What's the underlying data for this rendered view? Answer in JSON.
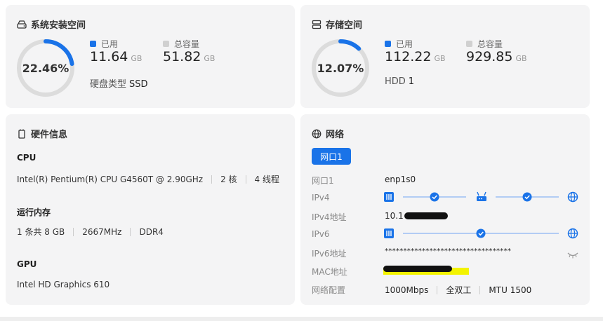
{
  "system_disk": {
    "title": "系统安装空间",
    "percent_text": "22.46%",
    "percent": 22.46,
    "used_label": "已用",
    "used_value": "11.64",
    "used_unit": "GB",
    "total_label": "总容量",
    "total_value": "51.82",
    "total_unit": "GB",
    "type_label": "硬盘类型",
    "type_value": "SSD"
  },
  "storage": {
    "title": "存储空间",
    "percent_text": "12.07%",
    "percent": 12.07,
    "used_label": "已用",
    "used_value": "112.22",
    "used_unit": "GB",
    "total_label": "总容量",
    "total_value": "929.85",
    "total_unit": "GB",
    "type_label": "HDD",
    "type_value": "1"
  },
  "hardware": {
    "title": "硬件信息",
    "cpu_label": "CPU",
    "cpu_model": "Intel(R) Pentium(R) CPU G4560T @ 2.90GHz",
    "cpu_cores": "2 核",
    "cpu_threads": "4 线程",
    "mem_label": "运行内存",
    "mem_size": "1 条共 8 GB",
    "mem_speed": "2667MHz",
    "mem_type": "DDR4",
    "gpu_label": "GPU",
    "gpu_model": "Intel HD Graphics 610"
  },
  "network": {
    "title": "网络",
    "tab_label": "网口1",
    "rows": {
      "port_label": "网口1",
      "port_value": "enp1s0",
      "ipv4_label": "IPv4",
      "ipv4_addr_label": "IPv4地址",
      "ipv4_addr_value": "10.1",
      "ipv6_label": "IPv6",
      "ipv6_addr_label": "IPv6地址",
      "ipv6_addr_value": "**********************************",
      "mac_label": "MAC地址",
      "config_label": "网络配置",
      "speed": "1000Mbps",
      "duplex": "全双工",
      "mtu": "MTU 1500"
    }
  },
  "colors": {
    "accent": "#1a73e8",
    "ring_track": "#dcdcdc",
    "card_bg": "#f4f4f5",
    "used_dot": "#1a73e8",
    "total_dot": "#d0d0d0",
    "highlight": "#f3f300"
  },
  "icons": {
    "system_disk": "hard-drive-icon",
    "storage": "server-icon",
    "hardware": "chip-icon",
    "network": "globe-icon"
  }
}
